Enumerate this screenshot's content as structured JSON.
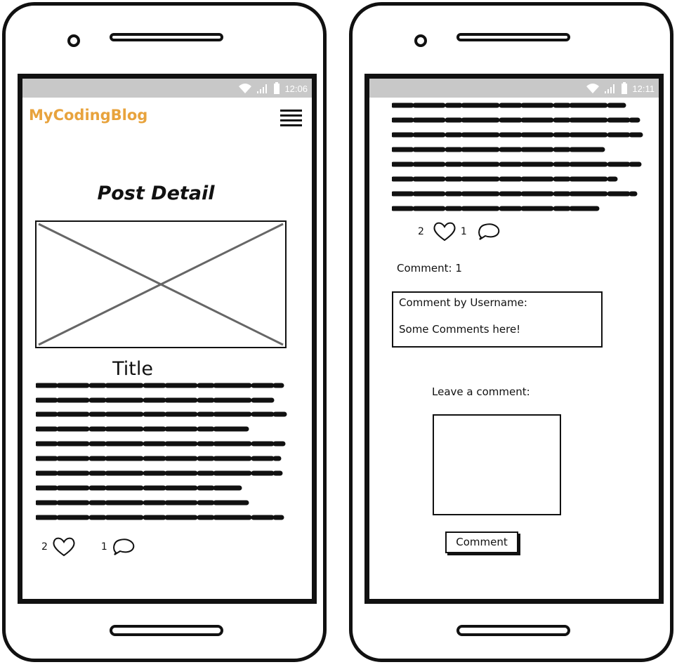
{
  "screens": {
    "left": {
      "status_time": "12:06",
      "brand": "MyCodingBlog",
      "page_heading": "Post Detail",
      "post_title": "Title",
      "likes_count": "2",
      "comments_count": "1"
    },
    "right": {
      "status_time": "12:11",
      "likes_count": "2",
      "comments_count": "1",
      "comment_count_label": "Comment: 1",
      "comment_author": "Comment by Username:",
      "comment_text": "Some Comments here!",
      "leave_comment_label": "Leave a comment:",
      "submit_label": "Comment"
    }
  },
  "colors": {
    "brand": "#e8a33d",
    "statusbar": "#c8c8c8",
    "ink": "#111111"
  },
  "icons": [
    "wifi-icon",
    "signal-icon",
    "battery-icon",
    "menu-icon",
    "heart-icon",
    "comment-bubble-icon"
  ]
}
